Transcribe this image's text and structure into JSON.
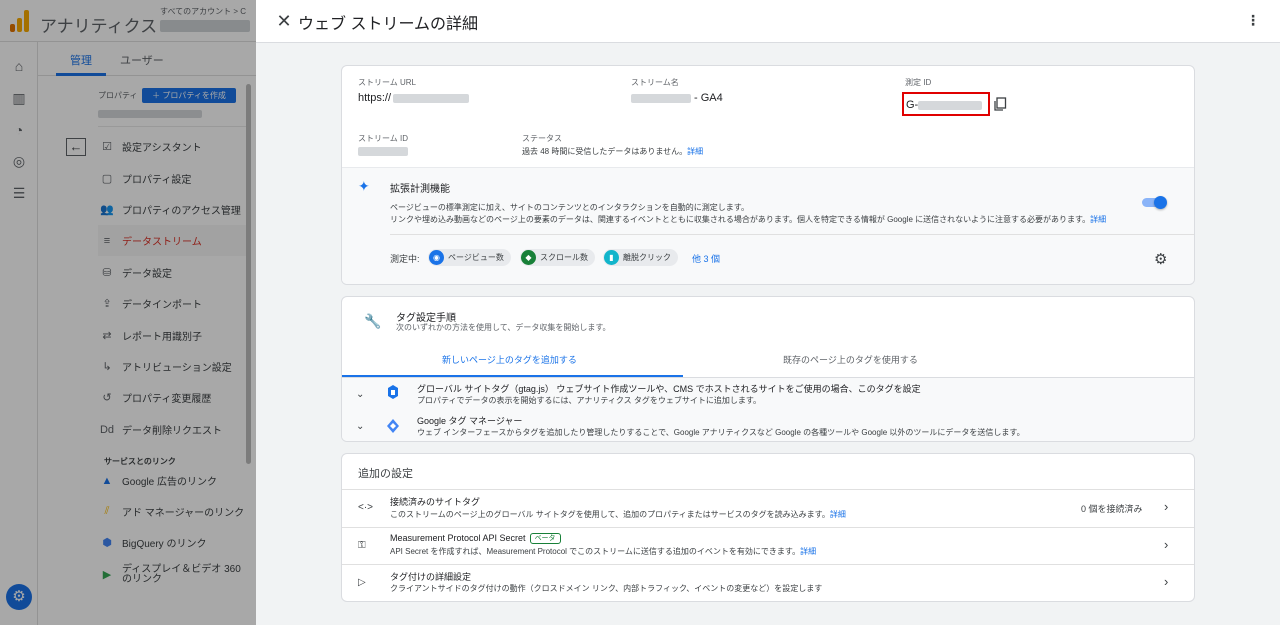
{
  "bg": {
    "app_name": "アナリティクス",
    "crumb": "すべてのアカウント > C",
    "tabs": [
      "管理",
      "ユーザー"
    ],
    "property_label": "プロパティ",
    "create_property": "＋ プロパティを作成",
    "nav_items": [
      {
        "label": "設定アシスタント",
        "icon": "checklist-icon"
      },
      {
        "label": "プロパティ設定",
        "icon": "property-settings-icon"
      },
      {
        "label": "プロパティのアクセス管理",
        "icon": "people-icon"
      },
      {
        "label": "データストリーム",
        "icon": "stream-icon"
      },
      {
        "label": "データ設定",
        "icon": "database-icon"
      },
      {
        "label": "データインポート",
        "icon": "upload-icon"
      },
      {
        "label": "レポート用識別子",
        "icon": "identifier-icon"
      },
      {
        "label": "アトリビューション設定",
        "icon": "attribution-icon"
      },
      {
        "label": "プロパティ変更履歴",
        "icon": "history-icon"
      },
      {
        "label": "データ削除リクエスト",
        "icon": "delete-request-icon"
      }
    ],
    "section_label": "サービスとのリンク",
    "link_items": [
      {
        "label": "Google 広告のリンク",
        "icon": "google-ads-icon"
      },
      {
        "label": "アド マネージャーのリンク",
        "icon": "ad-manager-icon"
      },
      {
        "label": "BigQuery のリンク",
        "icon": "bigquery-icon"
      },
      {
        "label": "ディスプレイ＆ビデオ 360\nのリンク",
        "icon": "dv360-icon"
      }
    ]
  },
  "panel": {
    "title": "ウェブ ストリームの詳細",
    "stream_url_label": "ストリーム URL",
    "stream_url_value": "https://",
    "stream_name_label": "ストリーム名",
    "stream_name_value": "- GA4",
    "measurement_id_label": "測定 ID",
    "measurement_id_value": "G-",
    "stream_id_label": "ストリーム ID",
    "status_label": "ステータス",
    "status_value": "過去 48 時間に受信したデータはありません。",
    "status_link": "詳細",
    "enhanced": {
      "title": "拡張計測機能",
      "desc1": "ページビューの標準測定に加え、サイトのコンテンツとのインタラクションを自動的に測定します。",
      "desc2": "リンクや埋め込み動画などのページ上の要素のデータは、関連するイベントとともに収集される場合があります。個人を特定できる情報が Google に送信されないように注意する必要があります。",
      "desc_link": "詳細",
      "enabled": true,
      "measuring_label": "測定中:",
      "chips": [
        {
          "label": "ページビュー数",
          "icon": "eye-icon",
          "color": "#1a73e8"
        },
        {
          "label": "スクロール数",
          "icon": "scroll-icon",
          "color": "#188038"
        },
        {
          "label": "離脱クリック",
          "icon": "lock-icon",
          "color": "#12b5cb"
        }
      ],
      "more": "他 3 個"
    },
    "tagging": {
      "title": "タグ設定手順",
      "subtitle": "次のいずれかの方法を使用して、データ収集を開始します。",
      "tab_new": "新しいページ上のタグを追加する",
      "tab_existing": "既存のページ上のタグを使用する",
      "option1_title": "グローバル サイトタグ（gtag.js） ウェブサイト作成ツールや、CMS でホストされるサイトをご使用の場合、このタグを設定",
      "option1_desc": "プロパティでデータの表示を開始するには、アナリティクス タグをウェブサイトに追加します。",
      "option2_title": "Google タグ マネージャー",
      "option2_desc": "ウェブ インターフェースからタグを追加したり管理したりすることで、Google アナリティクスなど Google の各種ツールや Google 以外のツールにデータを送信します。"
    },
    "additional": {
      "title": "追加の設定",
      "rows": [
        {
          "title": "接続済みのサイトタグ",
          "desc": "このストリームのページ上のグローバル サイトタグを使用して、追加のプロパティまたはサービスのタグを読み込みます。",
          "link": "詳細",
          "right": "0 個を接続済み"
        },
        {
          "title": "Measurement Protocol API Secret",
          "badge": "ベータ",
          "desc": "API Secret を作成すれば、Measurement Protocol でこのストリームに送信する追加のイベントを有効にできます。",
          "link": "詳細"
        },
        {
          "title": "タグ付けの詳細設定",
          "desc": "クライアントサイドのタグ付けの動作（クロスドメイン リンク、内部トラフィック、イベントの変更など）を設定します"
        }
      ]
    }
  }
}
